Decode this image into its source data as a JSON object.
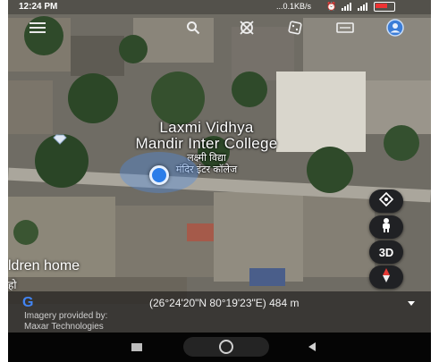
{
  "status_bar": {
    "time": "12:24 PM",
    "net_speed": "...0.1KB/s"
  },
  "toolbar": {
    "icons": [
      "menu-icon",
      "search-icon",
      "voyager-icon",
      "dice-icon",
      "map-style-icon",
      "account-icon"
    ]
  },
  "place": {
    "name_line1": "Laxmi Vidhya",
    "name_line2": "Mandir Inter College",
    "hindi_line1": "लक्ष्मी विद्या",
    "hindi_line2": "मंदिर इंटर कॉलेज"
  },
  "partial_label": "ldren home",
  "partial_label2": "हो",
  "controls": {
    "three_d": "3D"
  },
  "info": {
    "logo": "G",
    "coords": "(26°24'20\"N 80°19'23\"E) 484 m",
    "credit_line1": "Imagery provided by:",
    "credit_line2": "Maxar Technologies"
  },
  "colors": {
    "location_dot": "#2b7de9",
    "fab_bg": "#202124"
  }
}
